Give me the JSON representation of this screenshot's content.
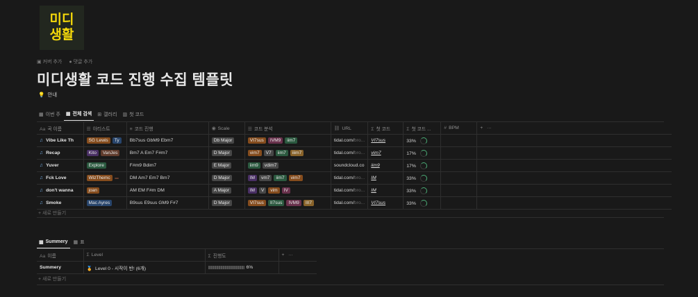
{
  "logo": {
    "line1": "미디",
    "line2": "생활"
  },
  "page_actions": {
    "add_cover": "커버 추가",
    "add_comment": "댓글 추가"
  },
  "title": "미디생활 코드 진행 수집 템플릿",
  "guide": "안내",
  "views": [
    {
      "label": "이번 주"
    },
    {
      "label": "전체 검색"
    },
    {
      "label": "갤러리"
    },
    {
      "label": "첫 코드"
    }
  ],
  "table1": {
    "columns": [
      "곡 이름",
      "아티스트",
      "코드 진행",
      "Scale",
      "코드 분석",
      "URL",
      "첫 코드",
      "첫 코드 ...",
      "BPM"
    ],
    "rows": [
      {
        "name": "Vibe Like Th",
        "artists": [
          {
            "t": "SG Lewis",
            "c": "orange"
          },
          {
            "t": "Ty",
            "c": "blue"
          }
        ],
        "progression": "Bb7sus GbM9 Ebm7",
        "scale": "Db Major",
        "analysis": [
          {
            "t": "VI7sus",
            "c": "orange"
          },
          {
            "t": "IVM9",
            "c": "pink"
          },
          {
            "t": "iim7",
            "c": "green"
          }
        ],
        "url": "tidal.com/",
        "url_fade": "bro...",
        "first": "VI7sus",
        "pct": "33%"
      },
      {
        "name": "Recap",
        "artists": [
          {
            "t": "Kito",
            "c": "purple"
          },
          {
            "t": "VanJes",
            "c": "brown"
          }
        ],
        "progression": "Bm7 A Em7 F#m7",
        "scale": "D Major",
        "analysis": [
          {
            "t": "vim7",
            "c": "orange"
          },
          {
            "t": "V7",
            "c": "gray"
          },
          {
            "t": "iim7",
            "c": "green"
          },
          {
            "t": "iiim7",
            "c": "yellow"
          }
        ],
        "url": "tidal.com/",
        "url_fade": "bro...",
        "first": "vim7",
        "pct": "17%"
      },
      {
        "name": "Yuver",
        "artists": [
          {
            "t": "Explore",
            "c": "green"
          }
        ],
        "progression": "F#m9 Bdim7",
        "scale": "E Major",
        "analysis": [
          {
            "t": "iim9",
            "c": "green"
          },
          {
            "t": "vdim7",
            "c": "gray"
          }
        ],
        "url": "soundcloud.co",
        "url_fade": "",
        "first": "iim9",
        "pct": "17%"
      },
      {
        "name": "Fck Love",
        "artists": [
          {
            "t": "WizThemc",
            "c": "orange"
          },
          {
            "t": " ",
            "c": "brown"
          }
        ],
        "progression": "DM Am7 Em7 Bm7",
        "scale": "D Major",
        "analysis": [
          {
            "t": "IM",
            "c": "purple"
          },
          {
            "t": "vm7",
            "c": "gray"
          },
          {
            "t": "iim7",
            "c": "green"
          },
          {
            "t": "vim7",
            "c": "orange"
          }
        ],
        "url": "tidal.com/",
        "url_fade": "bro...",
        "first": "IM",
        "pct": "33%"
      },
      {
        "name": "don't wanna",
        "artists": [
          {
            "t": "joan",
            "c": "orange"
          }
        ],
        "progression": "AM EM F#m DM",
        "scale": "A Major",
        "analysis": [
          {
            "t": "IM",
            "c": "purple"
          },
          {
            "t": "V",
            "c": "gray"
          },
          {
            "t": "vim",
            "c": "orange"
          },
          {
            "t": "IV",
            "c": "pink"
          }
        ],
        "url": "tidal.com/",
        "url_fade": "bro...",
        "first": "IM",
        "pct": "33%"
      },
      {
        "name": "Smoke",
        "artists": [
          {
            "t": "Mac Ayres",
            "c": "blue"
          }
        ],
        "progression": "B9sus E9sus GM9 F#7",
        "scale": "D Major",
        "analysis": [
          {
            "t": "VI7sus",
            "c": "orange"
          },
          {
            "t": "II7sus",
            "c": "green"
          },
          {
            "t": "IVM9",
            "c": "pink"
          },
          {
            "t": "III7",
            "c": "yellow"
          }
        ],
        "url": "tidal.com/",
        "url_fade": "bro...",
        "first": "VI7sus",
        "pct": "33%"
      }
    ],
    "new_row": "새로 만들기"
  },
  "views2": [
    {
      "label": "Summery"
    },
    {
      "label": "표"
    }
  ],
  "table2": {
    "columns": [
      "이름",
      "Level",
      "진행도"
    ],
    "row": {
      "name": "Summery",
      "level": "Level 0 - 시작이 반! (6개)",
      "progress": "6%"
    },
    "new_row": "새로 만들기"
  }
}
